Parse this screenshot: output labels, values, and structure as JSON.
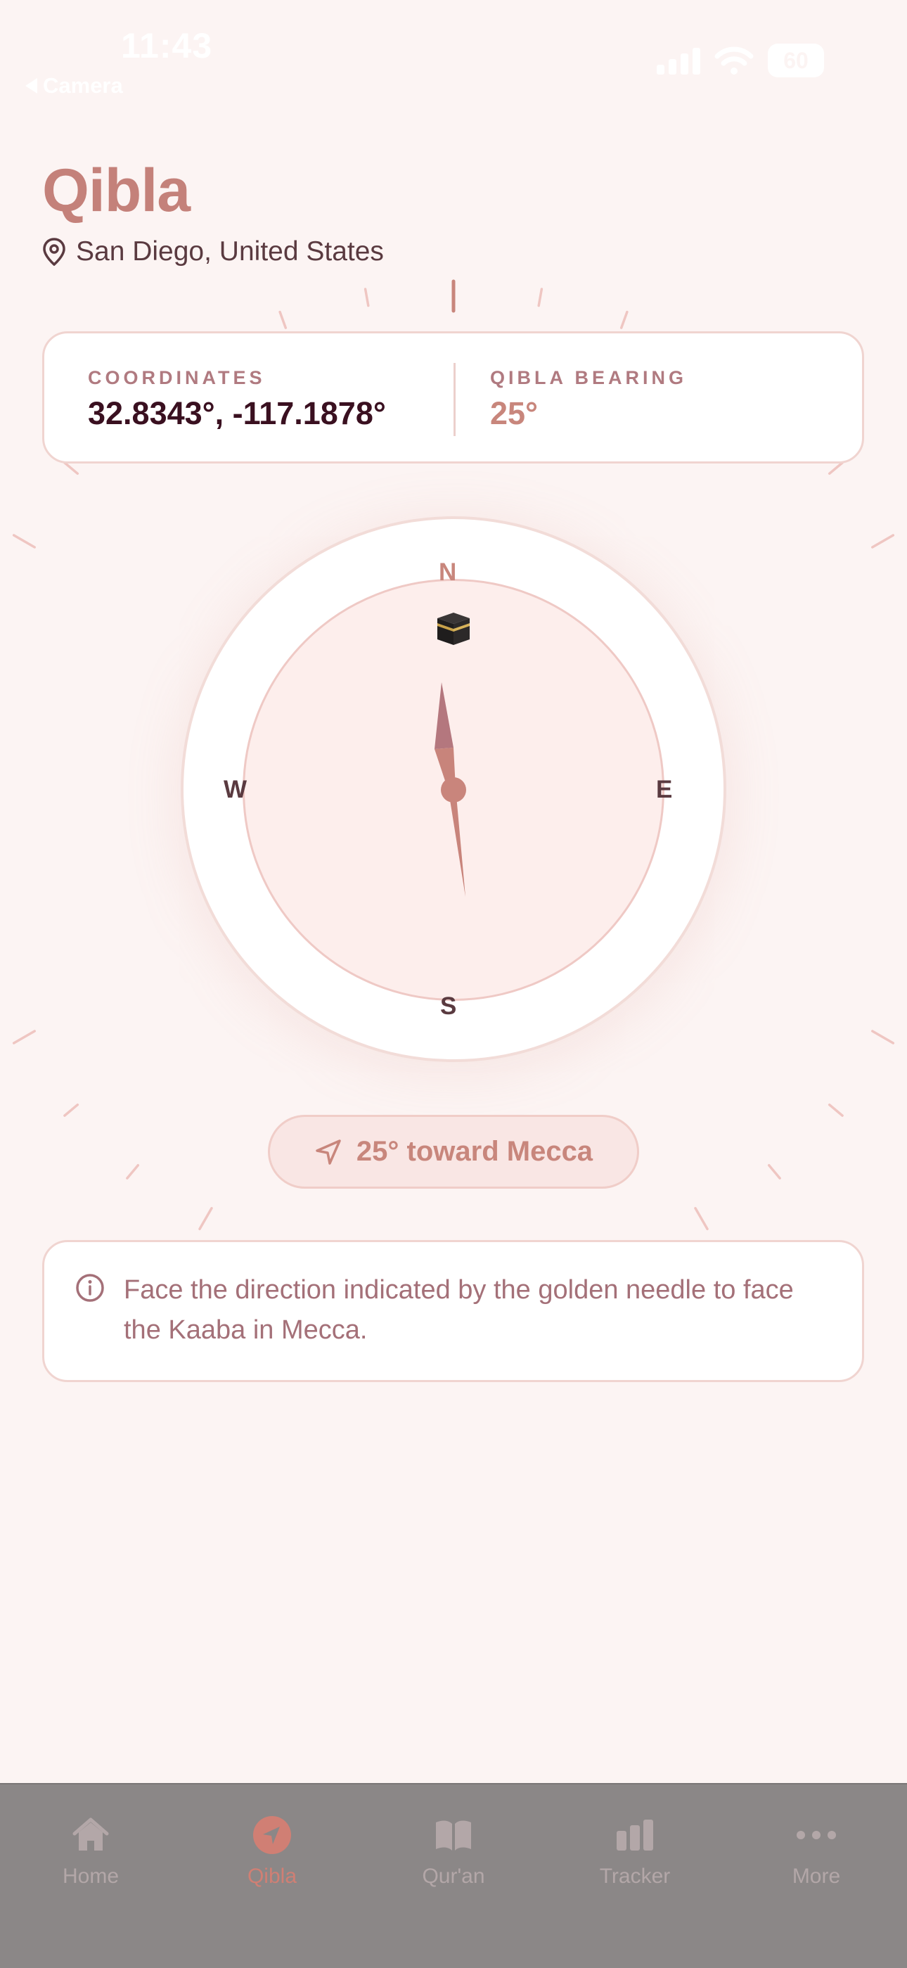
{
  "status_bar": {
    "time": "11:43",
    "back_app": "Camera",
    "battery": "60"
  },
  "header": {
    "title": "Qibla",
    "location": "San Diego, United States",
    "location_icon": "map-pin-icon"
  },
  "info_card": {
    "coordinates_label": "COORDINATES",
    "coordinates_value": "32.8343°, -117.1878°",
    "bearing_label": "QIBLA BEARING",
    "bearing_value": "25°"
  },
  "compass": {
    "north": "N",
    "east": "E",
    "south": "S",
    "west": "W",
    "kaaba_icon": "kaaba-icon",
    "needle_bearing_deg": 25
  },
  "direction_pill": {
    "icon": "navigation-arrow-icon",
    "text": "25° toward Mecca"
  },
  "tip": {
    "icon": "info-icon",
    "text": "Face the direction indicated by the golden needle to face the Kaaba in Mecca."
  },
  "tab_bar": {
    "active": "Qibla",
    "tabs": [
      {
        "label": "Home",
        "icon": "home-icon"
      },
      {
        "label": "Qibla",
        "icon": "compass-navigation-icon"
      },
      {
        "label": "Qur'an",
        "icon": "book-open-icon"
      },
      {
        "label": "Tracker",
        "icon": "bar-chart-icon"
      },
      {
        "label": "More",
        "icon": "more-dots-icon"
      }
    ]
  },
  "colors": {
    "background": "#fcf4f3",
    "accent": "#c4817a",
    "card_border": "#f0d4d0",
    "tab_bar": "#8b8787"
  }
}
